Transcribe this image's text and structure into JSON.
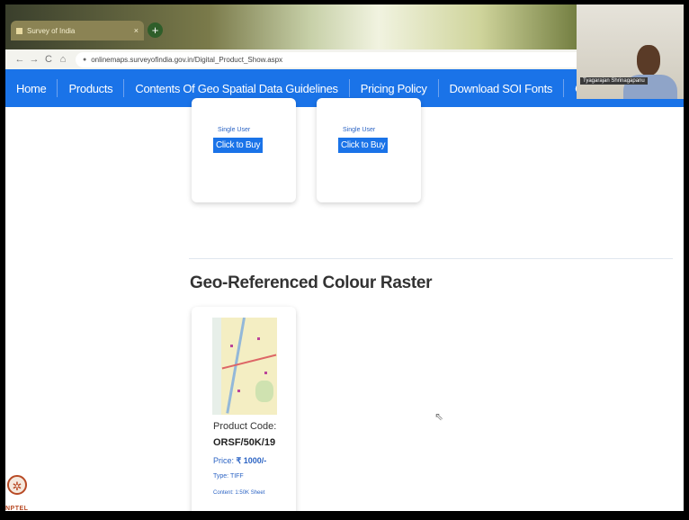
{
  "browser": {
    "tab_title": "Survey of India",
    "tab_close": "×",
    "new_tab": "+",
    "url": "onlinemaps.surveyofindia.gov.in/Digital_Product_Show.aspx",
    "nav_back": "←",
    "nav_forward": "→",
    "nav_reload": "C",
    "nav_home": "⌂"
  },
  "site_nav": {
    "items": [
      "Home",
      "Products",
      "Contents Of Geo Spatial Data Guidelines",
      "Pricing Policy",
      "Download SOI Fonts",
      "Contact Us"
    ],
    "cart_icon": "shopping-cart-icon"
  },
  "webcam": {
    "name_label": "Tyagarajan Shrinagapanu"
  },
  "product_cards_top": [
    {
      "user_type": "Single User",
      "buy_label": "Click to Buy"
    },
    {
      "user_type": "Single User",
      "buy_label": "Click to Buy"
    }
  ],
  "section": {
    "title": "Geo-Referenced Colour Raster"
  },
  "product": {
    "code_label": "Product Code:",
    "code_value": "ORSF/50K/19",
    "price_label": "Price:",
    "price_value": "₹ 1000/-",
    "type": "Type: TIFF",
    "content": "Content: 1:50K Sheet"
  },
  "watermark": {
    "logo_text": "NPTEL"
  },
  "colors": {
    "nav_blue": "#1a73e8",
    "link_blue": "#2c64c4"
  }
}
